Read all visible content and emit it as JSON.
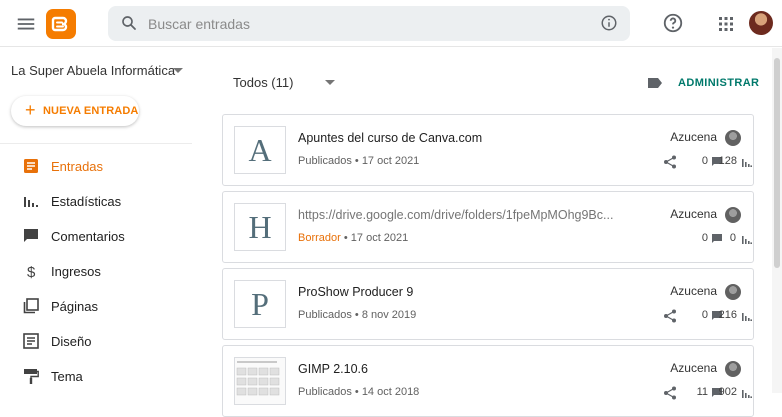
{
  "header": {
    "search_placeholder": "Buscar entradas"
  },
  "sidebar": {
    "blog_name": "La Super Abuela Informática",
    "new_post_label": "NUEVA ENTRADA",
    "items": [
      {
        "label": "Entradas",
        "icon": "posts-icon",
        "active": true
      },
      {
        "label": "Estadísticas",
        "icon": "stats-icon",
        "active": false
      },
      {
        "label": "Comentarios",
        "icon": "comments-icon",
        "active": false
      },
      {
        "label": "Ingresos",
        "icon": "dollar-icon",
        "active": false
      },
      {
        "label": "Páginas",
        "icon": "pages-icon",
        "active": false
      },
      {
        "label": "Diseño",
        "icon": "layout-icon",
        "active": false
      },
      {
        "label": "Tema",
        "icon": "theme-icon",
        "active": false
      }
    ]
  },
  "main": {
    "filter_label": "Todos (11)",
    "manage_label": "ADMINISTRAR",
    "posts": [
      {
        "thumb_letter": "A",
        "title": "Apuntes del curso de Canva.com",
        "status": "Publicados",
        "date": "17 oct 2021",
        "author": "Azucena",
        "comments": "0",
        "views": "128"
      },
      {
        "thumb_letter": "H",
        "title": "https://drive.google.com/drive/folders/1fpeMpMOhg9Bc...",
        "status": "Borrador",
        "date": "17 oct 2021",
        "author": "Azucena",
        "comments": "0",
        "views": "0"
      },
      {
        "thumb_letter": "P",
        "title": "ProShow Producer 9",
        "status": "Publicados",
        "date": "8 nov 2019",
        "author": "Azucena",
        "comments": "0",
        "views": "216"
      },
      {
        "thumb_letter": "",
        "title": "GIMP 2.10.6",
        "status": "Publicados",
        "date": "14 oct 2018",
        "author": "Azucena",
        "comments": "11",
        "views": "902"
      }
    ]
  },
  "colors": {
    "accent": "#f57c00",
    "manage": "#00796b",
    "draft": "#e8710a"
  }
}
